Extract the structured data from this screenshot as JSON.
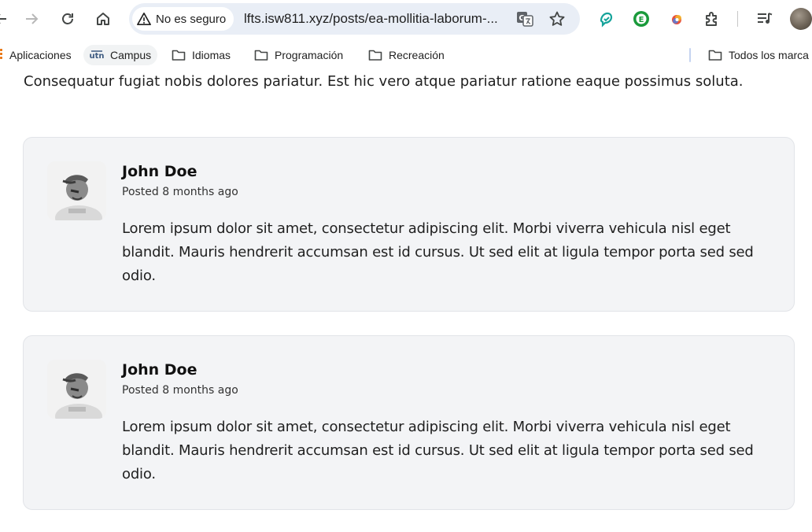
{
  "browser": {
    "security_chip": "No es seguro",
    "url": "lfts.isw811.xyz/posts/ea-mollitia-laborum-...",
    "icons": {
      "back": "arrow-left-icon",
      "forward": "arrow-right-icon",
      "reload": "reload-icon",
      "home": "home-icon",
      "warning": "warning-icon",
      "translate": "translate-icon",
      "bookmark_star": "star-icon",
      "extensions": [
        "grammar-extension-icon",
        "ecosia-extension-icon",
        "color-extension-icon",
        "puzzle-extensions-icon"
      ],
      "media": "media-control-icon",
      "profile": "profile-avatar"
    }
  },
  "bookmarks": {
    "items": [
      {
        "label": "Aplicaciones",
        "icon": "apps-grid-icon"
      },
      {
        "label": "Campus",
        "icon": "utn-logo-icon"
      },
      {
        "label": "Idiomas",
        "icon": "folder-icon"
      },
      {
        "label": "Programación",
        "icon": "folder-icon"
      },
      {
        "label": "Recreación",
        "icon": "folder-icon"
      }
    ],
    "all_bookmarks": "Todos los marca"
  },
  "post": {
    "body_tail": "Consequatur fugiat nobis dolores pariatur. Est hic vero atque pariatur ratione eaque possimus soluta."
  },
  "comments": [
    {
      "author": "John Doe",
      "posted": "Posted 8 months ago",
      "text": "Lorem ipsum dolor sit amet, consectetur adipiscing elit. Morbi viverra vehicula nisl eget blandit. Mauris hendrerit accumsan est id cursus. Ut sed elit at ligula tempor porta sed sed odio."
    },
    {
      "author": "John Doe",
      "posted": "Posted 8 months ago",
      "text": "Lorem ipsum dolor sit amet, consectetur adipiscing elit. Morbi viverra vehicula nisl eget blandit. Mauris hendrerit accumsan est id cursus. Ut sed elit at ligula tempor porta sed sed odio."
    }
  ],
  "colors": {
    "omnibox_bg": "#e9eef6",
    "comment_bg": "#f3f4f6",
    "comment_border": "#e2e4e8",
    "text": "#1f1f1f"
  }
}
